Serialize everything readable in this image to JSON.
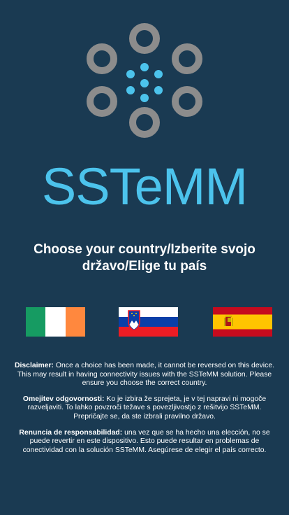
{
  "app": {
    "brand_name": "SSTeMM",
    "brand_color": "#4cc3ec",
    "background_color": "#1a3a52",
    "ring_color": "#8c8c8c"
  },
  "heading": "Choose your country/Izberite svojo državo/Elige tu país",
  "flags": [
    {
      "country": "Ireland",
      "icon": "ireland-flag-icon"
    },
    {
      "country": "Slovenia",
      "icon": "slovenia-flag-icon"
    },
    {
      "country": "Spain",
      "icon": "spain-flag-icon"
    }
  ],
  "disclaimers": [
    {
      "label": "Disclaimer:",
      "text": " Once a choice has been made, it cannot be reversed on this device. This may result in having connectivity issues with the SSTeMM solution. Please ensure you choose the correct country."
    },
    {
      "label": "Omejitev odgovornosti:",
      "text": " Ko je izbira že sprejeta, je v tej napravi ni mogoče razveljaviti. To lahko povzroči težave s povezljivostjo z rešitvijo SSTeMM. Prepričajte se, da ste izbrali pravilno državo."
    },
    {
      "label": "Renuncia de responsabilidad:",
      "text": " una vez que se ha hecho una elección, no se puede revertir en este dispositivo. Esto puede resultar en problemas de conectividad con la solución SSTeMM. Asegúrese de elegir el país correcto."
    }
  ]
}
